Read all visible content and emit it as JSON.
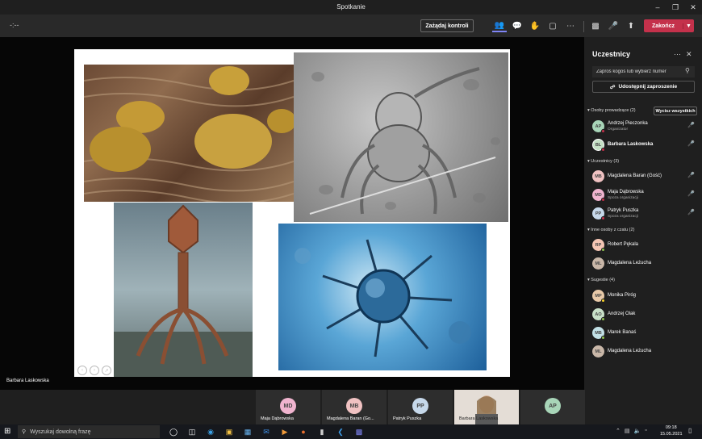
{
  "window": {
    "title": "Spotkanie"
  },
  "toolbar": {
    "timer": "-:--",
    "control_label": "Zażądaj kontroli",
    "end_label": "Zakończ",
    "accent": "#7f85f5",
    "end_color": "#c4314b"
  },
  "stage": {
    "speaker": "Barbara Laskowska"
  },
  "panel": {
    "title": "Uczestnicy",
    "search_placeholder": "Zaproś kogoś lub wybierz numer",
    "share_label": "Udostępnij zaproszenie",
    "show_all_label": "Wycisz wszystkich",
    "sections": {
      "presenters": "Osoby prowadzące (2)",
      "attendees": "Uczestnicy (3)",
      "others": "Inne osoby z czatu (2)",
      "suggestions": "Sugestie (4)"
    },
    "presenters": [
      {
        "initials": "AP",
        "name": "Andrzej Pieczonka",
        "sub": "Organizator",
        "color": "#a8d5b8"
      },
      {
        "initials": "BL",
        "name": "Barbara Laskowska",
        "sub": "",
        "color": "#c5e0c5"
      }
    ],
    "attendees": [
      {
        "initials": "MB",
        "name": "Magdalena Baran (Gość)",
        "sub": "",
        "color": "#f0c2c2"
      },
      {
        "initials": "MD",
        "name": "Maja Dąbrowska",
        "sub": "Spoza organizacji",
        "color": "#f0b4cf"
      },
      {
        "initials": "PP",
        "name": "Patryk Puszka",
        "sub": "Spoza organizacji",
        "color": "#c6d8ea"
      }
    ],
    "others": [
      {
        "initials": "RP",
        "name": "Robert Pękala",
        "color": "#f5c6b4"
      },
      {
        "initials": "ML",
        "name": "Magdalena Leżucha",
        "color": "#c9b7a8"
      }
    ],
    "suggestions": [
      {
        "initials": "MP",
        "name": "Monika Piróg",
        "color": "#e8c9a8"
      },
      {
        "initials": "AO",
        "name": "Andrzej Olak",
        "color": "#c8e0c8"
      },
      {
        "initials": "MB",
        "name": "Marek Banaś",
        "color": "#c2e0e6"
      },
      {
        "initials": "ML",
        "name": "Magdalena Leżucha",
        "color": "#c9b7a8"
      }
    ]
  },
  "strip": [
    {
      "initials": "MD",
      "label": "Maja Dąbrowska",
      "color": "#f0b4cf"
    },
    {
      "initials": "MB",
      "label": "Magdalena Baran (Go...",
      "color": "#f0c2c2"
    },
    {
      "initials": "PP",
      "label": "Patryk Puszka",
      "color": "#c6d8ea"
    },
    {
      "initials": "",
      "label": "Barbara Laskowska",
      "color": "#d8cfc6"
    },
    {
      "initials": "AP",
      "label": "",
      "color": "#a8d5b8"
    }
  ],
  "taskbar": {
    "search_placeholder": "Wyszukaj dowolną frazę",
    "time": "09:18",
    "date": "15.05.2021"
  }
}
